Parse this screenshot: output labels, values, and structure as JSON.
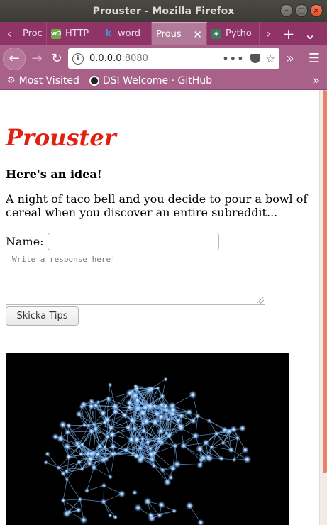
{
  "window": {
    "title": "Prouster - Mozilla Firefox"
  },
  "tabs": [
    {
      "label": "Proc",
      "icon": "generic-page-icon",
      "active": false
    },
    {
      "label": "HTTP",
      "icon": "w3-icon",
      "active": false
    },
    {
      "label": "word",
      "icon": "k-icon",
      "active": false
    },
    {
      "label": "Prous",
      "icon": "",
      "active": true
    },
    {
      "label": "Pytho",
      "icon": "python-icon",
      "active": false
    }
  ],
  "navbar": {
    "url_host": "0.0.0.0",
    "url_port": ":8080",
    "page_actions": "•••"
  },
  "bookmarks": [
    {
      "label": "Most Visited",
      "icon": "gear-icon"
    },
    {
      "label": "DSI Welcome · GitHub",
      "icon": "github-icon"
    }
  ],
  "page": {
    "title": "Prouster",
    "idea_heading": "Here's an idea!",
    "prompt": "A night of taco bell and you decide to pour a bowl of cereal when you discover an entire subreddit...",
    "name_label": "Name:",
    "name_value": "",
    "response_placeholder": "Write a response here!",
    "submit_label": "Skicka Tips"
  },
  "colors": {
    "tabstrip": "#8e3466",
    "toolbar": "#a8628a",
    "title_red": "#e02010",
    "scroll_thumb": "#e8826a"
  }
}
